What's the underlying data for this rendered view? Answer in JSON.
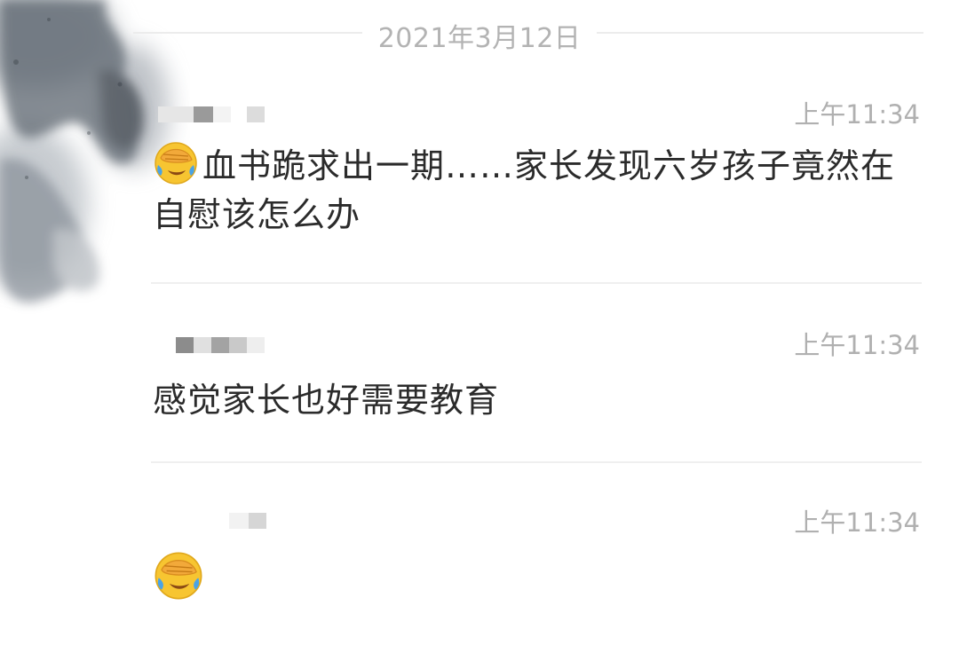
{
  "feed": {
    "date_label": "2021年3月12日",
    "comments": [
      {
        "username": "",
        "time": "上午11:34",
        "emoji": "face-palm-crying-emoji",
        "text": "血书跪求出一期……家长发现六岁孩子竟然在自慰该怎么办"
      },
      {
        "username": "",
        "time": "上午11:34",
        "text": "感觉家长也好需要教育"
      },
      {
        "username": "",
        "time": "上午11:34",
        "emoji": "face-palm-crying-emoji",
        "text": ""
      }
    ]
  },
  "colors": {
    "text": "#2b2b2b",
    "meta": "#b0b0b0",
    "divider": "#efefef"
  }
}
